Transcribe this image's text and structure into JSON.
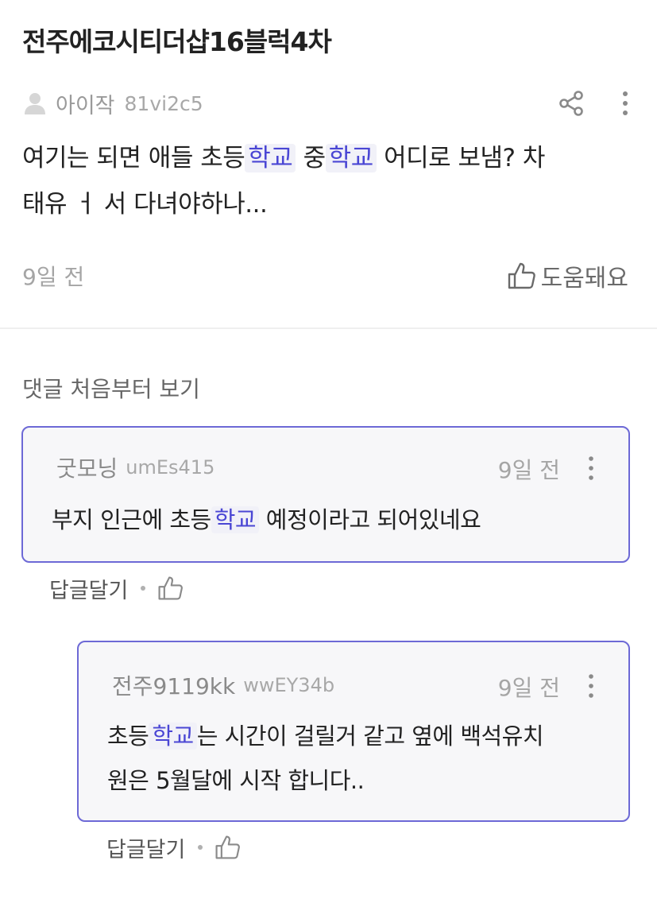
{
  "post": {
    "title": "전주에코시티더샵16블럭4차",
    "author": {
      "name": "아이작",
      "id": "81vi2c5"
    },
    "body_parts": [
      "여기는 되면 애들 초등",
      "학교",
      " 중",
      "학교",
      " 어디로 보냄? 차",
      "태유 ㅓ 서 다녀야하나..."
    ],
    "date": "9일 전",
    "helpful_label": "도움돼요"
  },
  "comments_heading": "댓글 처음부터 보기",
  "comments": [
    {
      "author": "굿모닝",
      "id": "umEs415",
      "date": "9일 전",
      "text_parts": [
        "부지 인근에 초등",
        "학교",
        " 예정이라고 되어있네요"
      ],
      "reply_label": "답글달기"
    },
    {
      "author": "전주9119kk",
      "id": "wwEY34b",
      "date": "9일 전",
      "text_parts": [
        "초등",
        "학교",
        "는 시간이 걸릴거 같고 옆에 백석유치",
        "원은 5월달에 시작 합니다.."
      ],
      "reply_label": "답글달기"
    }
  ],
  "colors": {
    "accent": "#6d69d6",
    "keyword_text": "#4a46d4",
    "keyword_bg": "#f1f1f8"
  },
  "icons": [
    "user-icon",
    "share-icon",
    "more-vertical-icon",
    "thumbs-up-icon"
  ]
}
